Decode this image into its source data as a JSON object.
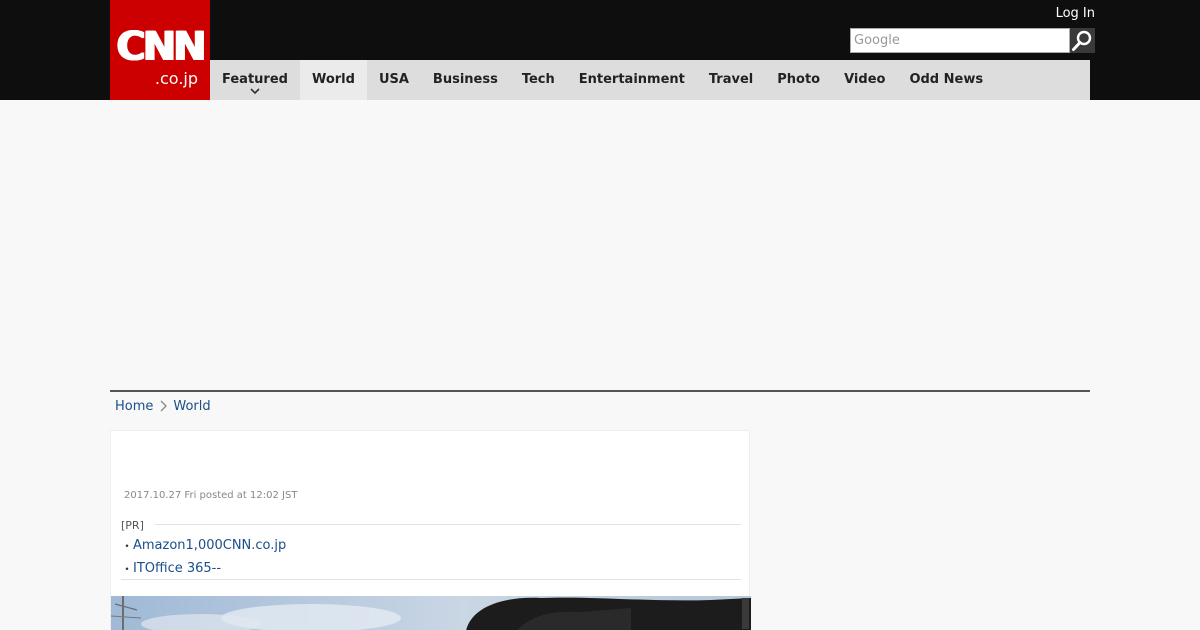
{
  "logo": {
    "mark": "CNN",
    "sub": ".co.jp"
  },
  "header": {
    "login_label": "Log In"
  },
  "search": {
    "placeholder": "Google"
  },
  "nav": {
    "items": [
      {
        "label": "Featured"
      },
      {
        "label": "World"
      },
      {
        "label": "USA"
      },
      {
        "label": "Business"
      },
      {
        "label": "Tech"
      },
      {
        "label": "Entertainment"
      },
      {
        "label": "Travel"
      },
      {
        "label": "Photo"
      },
      {
        "label": "Video"
      },
      {
        "label": "Odd News"
      }
    ]
  },
  "breadcrumb": {
    "home": "Home",
    "current": "World"
  },
  "article": {
    "timestamp": "2017.10.27 Fri posted at 12:02 JST",
    "pr_label": "[PR]",
    "pr_links": [
      {
        "bullet": "・",
        "text": "Amazon1,000CNN.co.jp"
      },
      {
        "bullet": "・",
        "text": "ITOffice 365--"
      }
    ]
  },
  "colors": {
    "brand_red": "#cc0000",
    "link_blue": "#1a4f8a",
    "nav_bg": "#dddddd",
    "topbar_bg": "#0e0e0e"
  }
}
